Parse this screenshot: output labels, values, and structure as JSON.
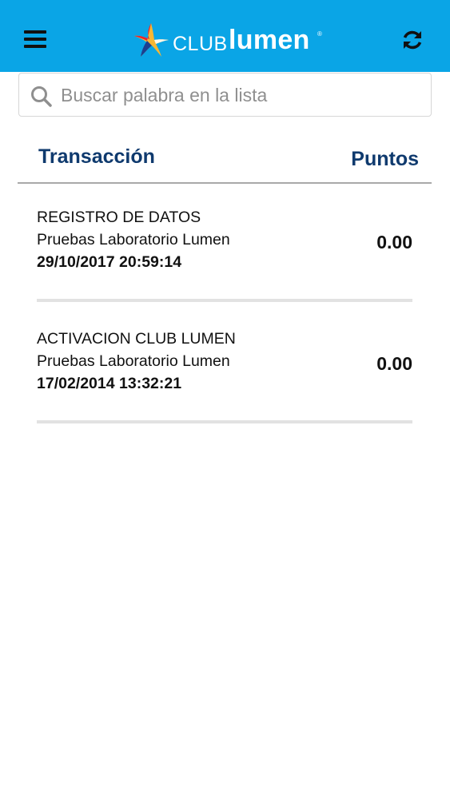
{
  "header": {
    "menu_icon": "hamburger-menu-icon",
    "logo_club": "CLUB",
    "logo_lumen": "lumen",
    "logo_reg": "®",
    "refresh_icon": "refresh-icon",
    "bar_color": "#0aa5e6"
  },
  "search": {
    "placeholder": "Buscar palabra en la lista",
    "value": "",
    "icon": "search-icon"
  },
  "columns": {
    "transaction": "Transacción",
    "points": "Puntos"
  },
  "transactions": [
    {
      "type": "REGISTRO DE DATOS",
      "store": "Pruebas Laboratorio Lumen",
      "datetime": "29/10/2017 20:59:14",
      "points": "0.00"
    },
    {
      "type": "ACTIVACION CLUB LUMEN",
      "store": "Pruebas Laboratorio Lumen",
      "datetime": "17/02/2014 13:32:21",
      "points": "0.00"
    }
  ],
  "colors": {
    "accent": "#0aa5e6",
    "header_text": "#0f3a6e"
  }
}
